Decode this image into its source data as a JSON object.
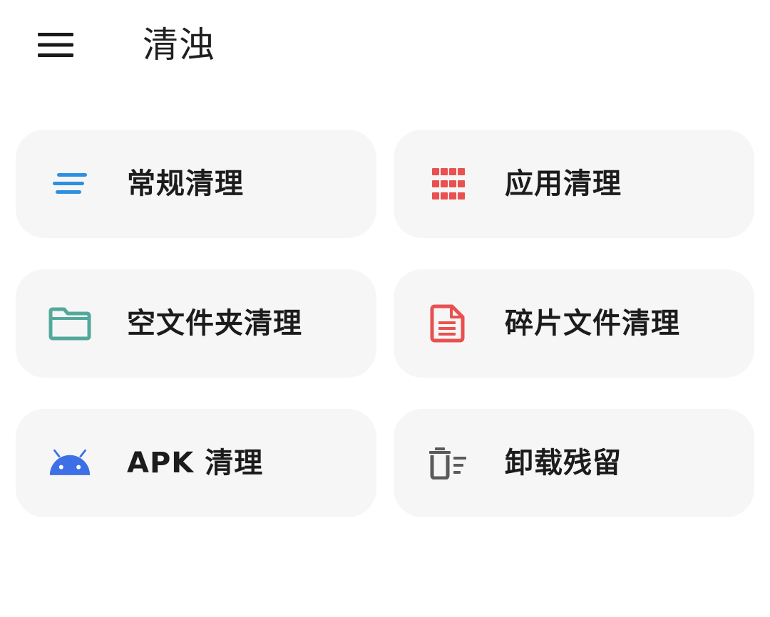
{
  "app_bar": {
    "title": "清浊",
    "menu_icon": "hamburger-menu-icon"
  },
  "colors": {
    "blue": "#2e8fe0",
    "red": "#e9504f",
    "teal": "#52a99b",
    "android_blue": "#3d6fe6",
    "gray": "#5a5a5a",
    "card_bg": "#f6f6f6"
  },
  "cards": [
    {
      "label": "常规清理",
      "icon": "lines-icon"
    },
    {
      "label": "应用清理",
      "icon": "grid-icon"
    },
    {
      "label": "空文件夹清理",
      "icon": "folder-icon"
    },
    {
      "label": "碎片文件清理",
      "icon": "document-icon"
    },
    {
      "label": "APK 清理",
      "icon": "android-icon"
    },
    {
      "label": "卸载残留",
      "icon": "trash-list-icon"
    }
  ]
}
